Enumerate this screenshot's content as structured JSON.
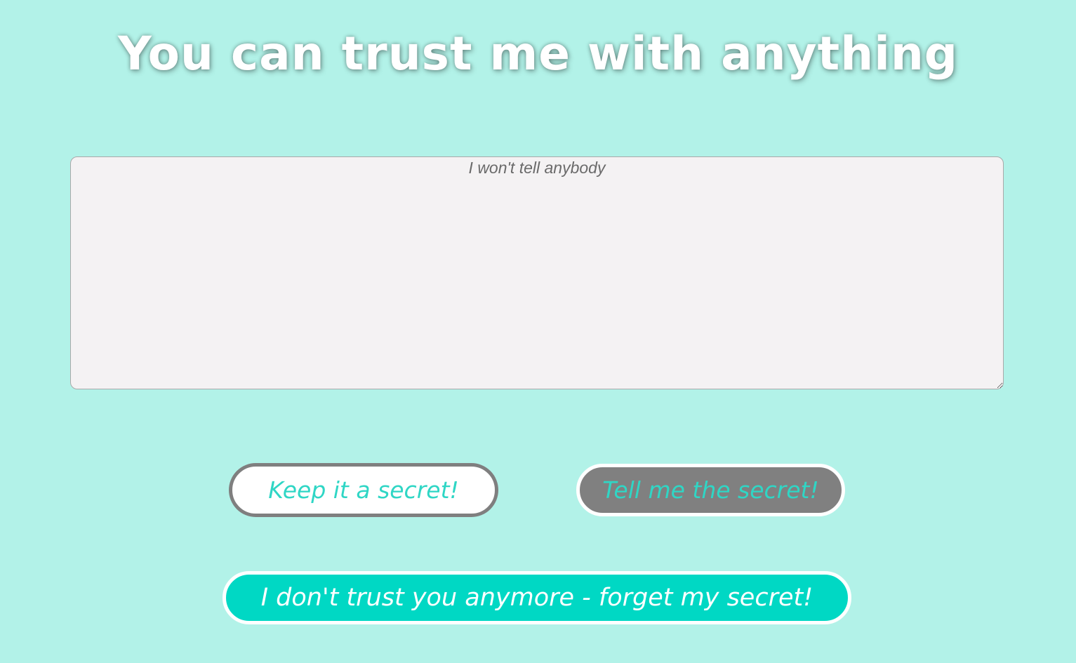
{
  "title": "You can trust me with anything",
  "secret_input": {
    "placeholder": "I won't tell anybody",
    "value": ""
  },
  "buttons": {
    "keep": "Keep it a secret!",
    "tell": "Tell me the secret!",
    "forget": "I don't trust you anymore - forget my secret!"
  },
  "colors": {
    "background": "#b2f2e8",
    "accent": "#00d8c4",
    "button_text": "#2fd6c5",
    "tell_button_bg": "#808080",
    "input_bg": "#f4f2f3"
  }
}
